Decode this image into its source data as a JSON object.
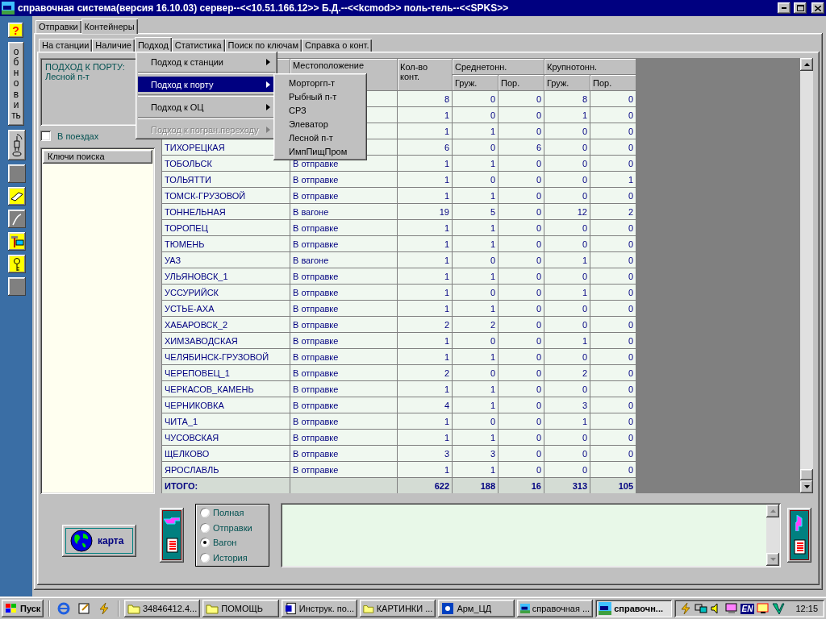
{
  "window": {
    "title": "справочная система(версия 16.10.03) сервер--<<10.51.166.12>> Б.Д.--<<kcmod>> поль-тель--<<SPKS>>"
  },
  "left_toolbar": [
    {
      "kind": "help",
      "label": "?"
    },
    {
      "kind": "refresh",
      "label": "обновить"
    },
    {
      "kind": "plug"
    },
    {
      "kind": "blank"
    },
    {
      "kind": "eraser"
    },
    {
      "kind": "line"
    },
    {
      "kind": "hammer"
    },
    {
      "kind": "key"
    },
    {
      "kind": "blank"
    }
  ],
  "tabs": [
    {
      "label": "Отправки",
      "selected": false
    },
    {
      "label": "Контейнеры",
      "selected": true
    }
  ],
  "subtabs": [
    {
      "label": "На станции",
      "selected": false
    },
    {
      "label": "Наличие",
      "selected": false
    },
    {
      "label": "Подход",
      "selected": true
    },
    {
      "label": "Статистика",
      "selected": false
    },
    {
      "label": "Поиск по ключам",
      "selected": false
    },
    {
      "label": "Справка о конт.",
      "selected": false
    }
  ],
  "approach_panel": {
    "title": "ПОДХОД К ПОРТУ:",
    "value": "Лесной п-т"
  },
  "in_trains": {
    "label": "В поездах",
    "checked": false
  },
  "search_keys": {
    "header": "Ключи поиска"
  },
  "table": {
    "header": {
      "location": "Местоположение",
      "count": "Кол-во конт.",
      "groups": [
        {
          "label": "Среднетонн.",
          "sub": [
            "Груж.",
            "Пор."
          ]
        },
        {
          "label": "Крупнотонн.",
          "sub": [
            "Груж.",
            "Пор."
          ]
        }
      ]
    },
    "rows": [
      {
        "values": [
          "8",
          "0",
          "0",
          "8",
          "0"
        ]
      },
      {
        "values": [
          "1",
          "0",
          "0",
          "1",
          "0"
        ]
      },
      {
        "values": [
          "1",
          "1",
          "0",
          "0",
          "0"
        ]
      },
      {
        "station": "ТИХОРЕЦКАЯ",
        "values": [
          "6",
          "0",
          "6",
          "0",
          "0"
        ]
      },
      {
        "station": "ТОБОЛЬСК",
        "status": "В отправке",
        "values": [
          "1",
          "1",
          "0",
          "0",
          "0"
        ]
      },
      {
        "station": "ТОЛЬЯТТИ",
        "status": "В отправке",
        "values": [
          "1",
          "0",
          "0",
          "0",
          "1"
        ]
      },
      {
        "station": "ТОМСК-ГРУЗОВОЙ",
        "status": "В отправке",
        "values": [
          "1",
          "1",
          "0",
          "0",
          "0"
        ]
      },
      {
        "station": "ТОННЕЛЬНАЯ",
        "status": "В вагоне",
        "values": [
          "19",
          "5",
          "0",
          "12",
          "2"
        ]
      },
      {
        "station": "ТОРОПЕЦ",
        "status": "В отправке",
        "values": [
          "1",
          "1",
          "0",
          "0",
          "0"
        ]
      },
      {
        "station": "ТЮМЕНЬ",
        "status": "В отправке",
        "values": [
          "1",
          "1",
          "0",
          "0",
          "0"
        ]
      },
      {
        "station": "УАЗ",
        "status": "В вагоне",
        "values": [
          "1",
          "0",
          "0",
          "1",
          "0"
        ]
      },
      {
        "station": "УЛЬЯНОВСК_1",
        "status": "В отправке",
        "values": [
          "1",
          "1",
          "0",
          "0",
          "0"
        ]
      },
      {
        "station": "УССУРИЙСК",
        "status": "В отправке",
        "values": [
          "1",
          "0",
          "0",
          "1",
          "0"
        ]
      },
      {
        "station": "УСТЬЕ-АХА",
        "status": "В отправке",
        "values": [
          "1",
          "1",
          "0",
          "0",
          "0"
        ]
      },
      {
        "station": "ХАБАРОВСК_2",
        "status": "В отправке",
        "values": [
          "2",
          "2",
          "0",
          "0",
          "0"
        ]
      },
      {
        "station": "ХИМЗАВОДСКАЯ",
        "status": "В отправке",
        "values": [
          "1",
          "0",
          "0",
          "1",
          "0"
        ]
      },
      {
        "station": "ЧЕЛЯБИНСК-ГРУЗОВОЙ",
        "status": "В отправке",
        "values": [
          "1",
          "1",
          "0",
          "0",
          "0"
        ]
      },
      {
        "station": "ЧЕРЕПОВЕЦ_1",
        "status": "В отправке",
        "values": [
          "2",
          "0",
          "0",
          "2",
          "0"
        ]
      },
      {
        "station": "ЧЕРКАСОВ_КАМЕНЬ",
        "status": "В отправке",
        "values": [
          "1",
          "1",
          "0",
          "0",
          "0"
        ]
      },
      {
        "station": "ЧЕРНИКОВКА",
        "status": "В отправке",
        "values": [
          "4",
          "1",
          "0",
          "3",
          "0"
        ]
      },
      {
        "station": "ЧИТА_1",
        "status": "В отправке",
        "values": [
          "1",
          "0",
          "0",
          "1",
          "0"
        ]
      },
      {
        "station": "ЧУСОВСКАЯ",
        "status": "В отправке",
        "values": [
          "1",
          "1",
          "0",
          "0",
          "0"
        ]
      },
      {
        "station": "ЩЕЛКОВО",
        "status": "В отправке",
        "values": [
          "3",
          "3",
          "0",
          "0",
          "0"
        ]
      },
      {
        "station": "ЯРОСЛАВЛЬ",
        "status": "В отправке",
        "values": [
          "1",
          "1",
          "0",
          "0",
          "0"
        ]
      }
    ],
    "total": {
      "label": "ИТОГО:",
      "values": [
        "622",
        "188",
        "16",
        "313",
        "105"
      ]
    }
  },
  "menu": {
    "items": [
      {
        "label": "Подход к станции",
        "selected": false,
        "disabled": false
      },
      {
        "label": "Подход к порту",
        "selected": true,
        "disabled": false
      },
      {
        "label": "Подход к ОЦ",
        "selected": false,
        "disabled": false
      },
      {
        "label": "Подход к погран.переходу",
        "selected": false,
        "disabled": true
      }
    ]
  },
  "submenu": {
    "items": [
      "Морторгп-т",
      "Рыбный п-т",
      "СРЗ",
      "Элеватор",
      "Лесной п-т",
      "ИмпПищПром"
    ]
  },
  "map_button": {
    "label": "карта"
  },
  "view_options": [
    {
      "label": "Полная",
      "selected": false
    },
    {
      "label": "Отправки",
      "selected": false
    },
    {
      "label": "Вагон",
      "selected": true
    },
    {
      "label": "История",
      "selected": false
    }
  ],
  "taskbar": {
    "start": "Пуск",
    "quick_launch": [
      {
        "kind": "browser"
      },
      {
        "kind": "notepad"
      },
      {
        "kind": "bolt"
      }
    ],
    "tasks": [
      {
        "label": "34846412.4...",
        "kind": "folder",
        "active": false
      },
      {
        "label": "ПОМОЩЬ",
        "kind": "folder",
        "active": false
      },
      {
        "label": "Инструк. по...",
        "kind": "document",
        "active": false
      },
      {
        "label": "КАРТИНКИ ...",
        "kind": "folder",
        "active": false
      },
      {
        "label": "Арм_ЦД",
        "kind": "app",
        "active": false
      },
      {
        "label": "справочная ...",
        "kind": "train",
        "active": false
      },
      {
        "label": "справочн...",
        "kind": "train",
        "active": true
      }
    ],
    "language": "EN",
    "clock": "12:15"
  }
}
